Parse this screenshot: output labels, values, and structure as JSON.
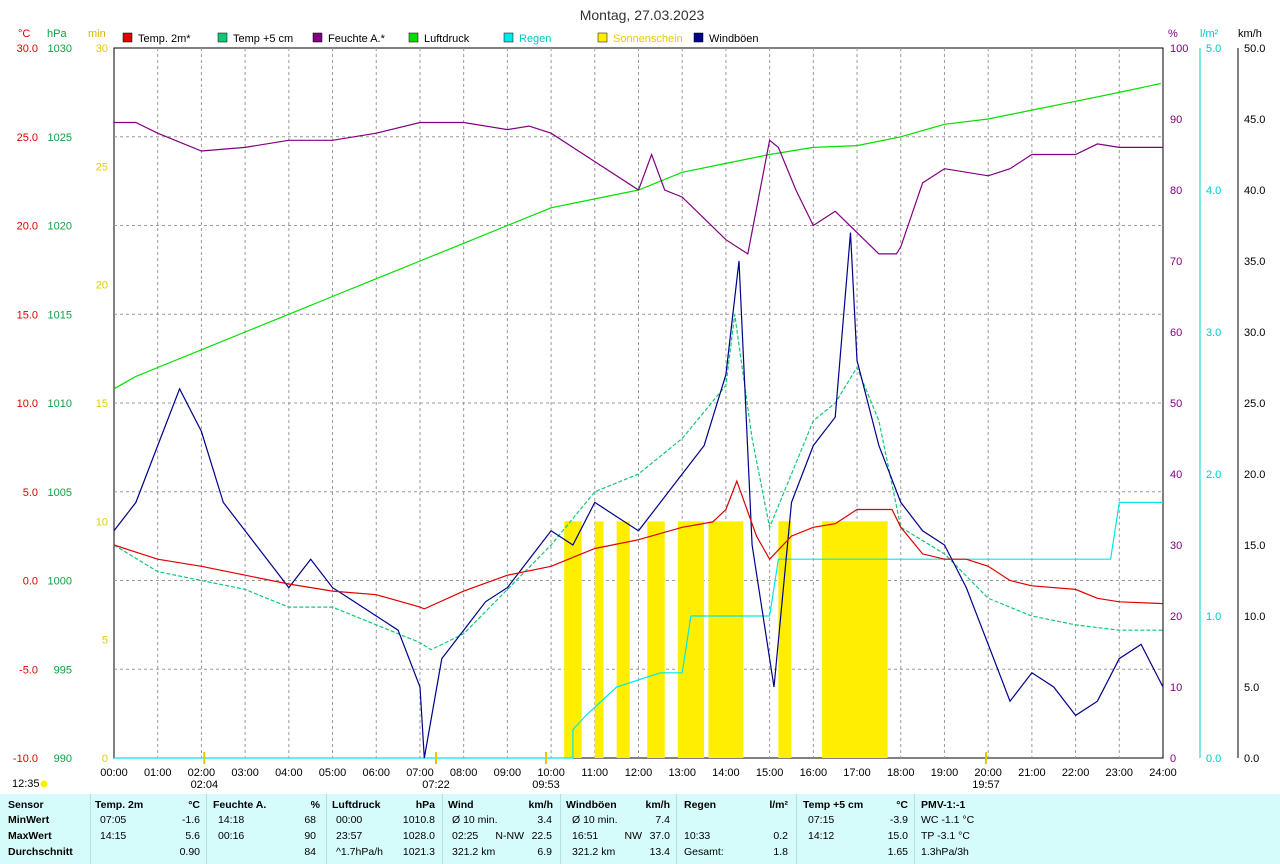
{
  "title": "Montag, 27.03.2023",
  "colors": {
    "temp2m": "#e00000",
    "temp5cm": "#10c878",
    "feuchte": "#800080",
    "luftdruck": "#00e000",
    "regen": "#00e8e8",
    "sonnenschein": "#ffee00",
    "windboeen": "#00008b",
    "grid": "#9a9a9a",
    "summary_bg": "#d6fbfb"
  },
  "legend": [
    {
      "label": "Temp. 2m*",
      "color": "#e00000"
    },
    {
      "label": "Temp +5 cm",
      "color": "#10c878"
    },
    {
      "label": "Feuchte A.*",
      "color": "#800080"
    },
    {
      "label": "Luftdruck",
      "color": "#00e000"
    },
    {
      "label": "Regen",
      "color": "#00e8e8"
    },
    {
      "label": "Sonnenschein",
      "color": "#ffee00"
    },
    {
      "label": "Windböen",
      "color": "#00008b"
    }
  ],
  "axes": {
    "temp": {
      "unit": "°C",
      "ticks": [
        "30.0",
        "25.0",
        "20.0",
        "15.0",
        "10.0",
        "5.0",
        "0.0",
        "-5.0",
        "-10.0"
      ]
    },
    "pressure": {
      "unit": "hPa",
      "ticks": [
        "1030",
        "1025",
        "1020",
        "1015",
        "1010",
        "1005",
        "1000",
        "995",
        "990"
      ]
    },
    "minutes": {
      "unit": "min",
      "ticks": [
        "30",
        "25",
        "20",
        "15",
        "10",
        "5",
        "0"
      ]
    },
    "humidity": {
      "unit": "%",
      "ticks": [
        "100",
        "90",
        "80",
        "70",
        "60",
        "50",
        "40",
        "30",
        "20",
        "10",
        "0"
      ]
    },
    "rain": {
      "unit": "l/m²",
      "ticks": [
        "5.0",
        "4.0",
        "3.0",
        "2.0",
        "1.0",
        "0.0"
      ]
    },
    "wind": {
      "unit": "km/h",
      "ticks": [
        "50.0",
        "45.0",
        "40.0",
        "35.0",
        "30.0",
        "25.0",
        "20.0",
        "15.0",
        "10.0",
        "5.0",
        "0.0"
      ]
    },
    "time": {
      "ticks": [
        "00:00",
        "01:00",
        "02:00",
        "03:00",
        "04:00",
        "05:00",
        "06:00",
        "07:00",
        "08:00",
        "09:00",
        "10:00",
        "11:00",
        "12:00",
        "13:00",
        "14:00",
        "15:00",
        "16:00",
        "17:00",
        "18:00",
        "19:00",
        "20:00",
        "21:00",
        "22:00",
        "23:00",
        "24:00"
      ]
    }
  },
  "sun_markers": {
    "moonset": "12:35",
    "moonrise": "02:04",
    "sunrise": "07:22",
    "moon_culmination": "09:53",
    "sunset": "19:57"
  },
  "chart_data": {
    "type": "line",
    "title": "Montag, 27.03.2023",
    "x_unit": "hours",
    "series": [
      {
        "name": "Temp. 2m*",
        "unit": "°C",
        "points": [
          [
            0,
            2.0
          ],
          [
            1,
            1.2
          ],
          [
            2,
            0.8
          ],
          [
            3,
            0.3
          ],
          [
            4,
            -0.2
          ],
          [
            5,
            -0.6
          ],
          [
            6,
            -0.8
          ],
          [
            7,
            -1.5
          ],
          [
            7.1,
            -1.6
          ],
          [
            8,
            -0.6
          ],
          [
            9,
            0.3
          ],
          [
            10,
            0.8
          ],
          [
            11,
            1.8
          ],
          [
            12,
            2.3
          ],
          [
            13,
            3.0
          ],
          [
            13.7,
            3.3
          ],
          [
            14,
            4.0
          ],
          [
            14.25,
            5.6
          ],
          [
            14.7,
            2.5
          ],
          [
            15,
            1.2
          ],
          [
            15.5,
            2.5
          ],
          [
            16,
            3.0
          ],
          [
            16.5,
            3.2
          ],
          [
            17,
            4.0
          ],
          [
            17.8,
            4.0
          ],
          [
            18,
            3.0
          ],
          [
            18.5,
            1.5
          ],
          [
            19,
            1.2
          ],
          [
            19.5,
            1.2
          ],
          [
            20,
            0.8
          ],
          [
            20.5,
            0.0
          ],
          [
            21,
            -0.3
          ],
          [
            22,
            -0.5
          ],
          [
            22.5,
            -1.0
          ],
          [
            23,
            -1.2
          ],
          [
            24,
            -1.3
          ]
        ]
      },
      {
        "name": "Temp +5 cm",
        "unit": "°C",
        "points": [
          [
            0,
            2.0
          ],
          [
            1,
            0.5
          ],
          [
            2,
            0.0
          ],
          [
            3,
            -0.5
          ],
          [
            4,
            -1.5
          ],
          [
            5,
            -1.5
          ],
          [
            6,
            -2.5
          ],
          [
            7,
            -3.5
          ],
          [
            7.25,
            -3.9
          ],
          [
            8,
            -3.0
          ],
          [
            9,
            -0.5
          ],
          [
            10,
            2.0
          ],
          [
            11,
            5.0
          ],
          [
            12,
            6.0
          ],
          [
            13,
            8.0
          ],
          [
            14,
            11.0
          ],
          [
            14.2,
            15.0
          ],
          [
            14.6,
            8.0
          ],
          [
            15,
            3.0
          ],
          [
            15.5,
            6.0
          ],
          [
            16,
            9.0
          ],
          [
            16.5,
            10.0
          ],
          [
            17,
            12.0
          ],
          [
            17.5,
            9.0
          ],
          [
            18,
            3.0
          ],
          [
            19,
            1.5
          ],
          [
            20,
            -1.0
          ],
          [
            21,
            -2.0
          ],
          [
            22,
            -2.5
          ],
          [
            23,
            -2.8
          ],
          [
            24,
            -2.8
          ]
        ]
      },
      {
        "name": "Feuchte A.*",
        "unit": "%",
        "points": [
          [
            0,
            89.5
          ],
          [
            0.5,
            89.5
          ],
          [
            1,
            88
          ],
          [
            2,
            85.5
          ],
          [
            3,
            86
          ],
          [
            4,
            87
          ],
          [
            5,
            87
          ],
          [
            6,
            88
          ],
          [
            7,
            89.5
          ],
          [
            8,
            89.5
          ],
          [
            9,
            88.5
          ],
          [
            9.5,
            89
          ],
          [
            10,
            88
          ],
          [
            11,
            84
          ],
          [
            12,
            80
          ],
          [
            12.3,
            85
          ],
          [
            12.6,
            80
          ],
          [
            13,
            79
          ],
          [
            13.5,
            76
          ],
          [
            14,
            73
          ],
          [
            14.5,
            71
          ],
          [
            15,
            87
          ],
          [
            15.2,
            86
          ],
          [
            15.6,
            80
          ],
          [
            16,
            75
          ],
          [
            16.5,
            77
          ],
          [
            17,
            74
          ],
          [
            17.5,
            71
          ],
          [
            17.9,
            71
          ],
          [
            18,
            72
          ],
          [
            18.5,
            81
          ],
          [
            19,
            83
          ],
          [
            20,
            82
          ],
          [
            20.5,
            83
          ],
          [
            21,
            85
          ],
          [
            22,
            85
          ],
          [
            22.5,
            86.5
          ],
          [
            23,
            86
          ],
          [
            24,
            86
          ]
        ]
      },
      {
        "name": "Luftdruck",
        "unit": "hPa",
        "points": [
          [
            0,
            1010.8
          ],
          [
            0.5,
            1011.5
          ],
          [
            1,
            1012
          ],
          [
            2,
            1013
          ],
          [
            3,
            1014
          ],
          [
            4,
            1015
          ],
          [
            5,
            1016
          ],
          [
            6,
            1017
          ],
          [
            7,
            1018
          ],
          [
            8,
            1019
          ],
          [
            9,
            1020
          ],
          [
            10,
            1021
          ],
          [
            11,
            1021.5
          ],
          [
            12,
            1022
          ],
          [
            13,
            1023
          ],
          [
            14,
            1023.5
          ],
          [
            15,
            1024
          ],
          [
            16,
            1024.4
          ],
          [
            17,
            1024.5
          ],
          [
            18,
            1025
          ],
          [
            19,
            1025.7
          ],
          [
            20,
            1026
          ],
          [
            21,
            1026.5
          ],
          [
            22,
            1027
          ],
          [
            23,
            1027.5
          ],
          [
            23.95,
            1028.0
          ]
        ]
      },
      {
        "name": "Regen",
        "unit": "l/m²",
        "points": [
          [
            0,
            0
          ],
          [
            10.5,
            0
          ],
          [
            10.5,
            0.2
          ],
          [
            10.8,
            0.3
          ],
          [
            11.5,
            0.5
          ],
          [
            12.5,
            0.6
          ],
          [
            13.0,
            0.6
          ],
          [
            13.2,
            1.0
          ],
          [
            15.0,
            1.0
          ],
          [
            15.2,
            1.4
          ],
          [
            17.5,
            1.4
          ],
          [
            22.8,
            1.4
          ],
          [
            23.0,
            1.8
          ],
          [
            24,
            1.8
          ]
        ]
      },
      {
        "name": "Sonnenschein",
        "unit": "min",
        "intervals": [
          [
            10.3,
            10.7
          ],
          [
            11.0,
            11.2
          ],
          [
            11.5,
            11.8
          ],
          [
            12.2,
            12.6
          ],
          [
            12.9,
            13.5
          ],
          [
            13.6,
            14.4
          ],
          [
            15.2,
            15.5
          ],
          [
            16.2,
            17.7
          ]
        ]
      },
      {
        "name": "Windböen",
        "unit": "km/h",
        "points": [
          [
            0,
            16
          ],
          [
            0.5,
            18
          ],
          [
            1,
            22
          ],
          [
            1.5,
            26
          ],
          [
            2,
            23
          ],
          [
            2.5,
            18
          ],
          [
            3,
            16
          ],
          [
            3.5,
            14
          ],
          [
            4,
            12
          ],
          [
            4.5,
            14
          ],
          [
            5,
            12
          ],
          [
            5.5,
            11
          ],
          [
            6,
            10
          ],
          [
            6.5,
            9
          ],
          [
            7,
            5
          ],
          [
            7.1,
            0
          ],
          [
            7.5,
            7
          ],
          [
            8,
            9
          ],
          [
            8.5,
            11
          ],
          [
            9,
            12
          ],
          [
            9.5,
            14
          ],
          [
            10,
            16
          ],
          [
            10.5,
            15
          ],
          [
            11,
            18
          ],
          [
            11.5,
            17
          ],
          [
            12,
            16
          ],
          [
            12.5,
            18
          ],
          [
            13,
            20
          ],
          [
            13.5,
            22
          ],
          [
            14,
            27
          ],
          [
            14.3,
            35
          ],
          [
            14.6,
            15
          ],
          [
            15.1,
            5
          ],
          [
            15.5,
            18
          ],
          [
            16,
            22
          ],
          [
            16.5,
            24
          ],
          [
            16.85,
            37
          ],
          [
            17,
            28
          ],
          [
            17.5,
            22
          ],
          [
            18,
            18
          ],
          [
            18.5,
            16
          ],
          [
            19,
            15
          ],
          [
            19.5,
            12
          ],
          [
            20,
            8
          ],
          [
            20.5,
            4
          ],
          [
            21,
            6
          ],
          [
            21.5,
            5
          ],
          [
            22,
            3
          ],
          [
            22.5,
            4
          ],
          [
            23,
            7
          ],
          [
            23.5,
            8
          ],
          [
            24,
            5
          ]
        ]
      }
    ],
    "ranges": {
      "temp": [
        -10,
        30
      ],
      "pressure": [
        990,
        1030
      ],
      "humidity": [
        0,
        100
      ],
      "rain": [
        0,
        5
      ],
      "wind": [
        0,
        50
      ],
      "minutes": [
        0,
        30
      ],
      "x": [
        0,
        24
      ]
    }
  },
  "summary": {
    "headers": {
      "sensor": "Sensor",
      "temp2m": "Temp. 2m",
      "temp2m_unit": "°C",
      "feuchte": "Feuchte A.",
      "feuchte_unit": "%",
      "luftdruck": "Luftdruck",
      "luftdruck_unit": "hPa",
      "wind": "Wind",
      "wind_unit": "km/h",
      "boeen": "Windböen",
      "boeen_unit": "km/h",
      "regen": "Regen",
      "regen_unit": "l/m²",
      "temp5": "Temp +5 cm",
      "temp5_unit": "°C",
      "pmv": "PMV-1:-1"
    },
    "rows": [
      {
        "label": "MinWert",
        "t2_time": "07:05",
        "t2_val": "-1.6",
        "f_time": "14:18",
        "f_val": "68",
        "p_time": "00:00",
        "p_val": "1010.8",
        "w_label": "Ø 10 min.",
        "w_dir": "",
        "w_val": "3.4",
        "b_label": "Ø 10 min.",
        "b_dir": "",
        "b_val": "7.4",
        "r_label": "",
        "r_val": "",
        "t5_time": "07:15",
        "t5_val": "-3.9",
        "pmv": "WC -1.1 °C"
      },
      {
        "label": "MaxWert",
        "t2_time": "14:15",
        "t2_val": "5.6",
        "f_time": "00:16",
        "f_val": "90",
        "p_time": "23:57",
        "p_val": "1028.0",
        "w_label": "02:25",
        "w_dir": "N-NW",
        "w_val": "22.5",
        "b_label": "16:51",
        "b_dir": "NW",
        "b_val": "37.0",
        "r_label": "10:33",
        "r_val": "0.2",
        "t5_time": "14:12",
        "t5_val": "15.0",
        "pmv": "TP -3.1 °C"
      },
      {
        "label": "Durchschnitt",
        "t2_time": "",
        "t2_val": "0.90",
        "f_time": "",
        "f_val": "84",
        "p_time": "^1.7hPa/h",
        "p_val": "1021.3",
        "w_label": "321.2 km",
        "w_dir": "",
        "w_val": "6.9",
        "b_label": "321.2 km",
        "b_dir": "",
        "b_val": "13.4",
        "r_label": "Gesamt:",
        "r_val": "1.8",
        "t5_time": "",
        "t5_val": "1.65",
        "pmv": "1.3hPa/3h"
      }
    ]
  }
}
